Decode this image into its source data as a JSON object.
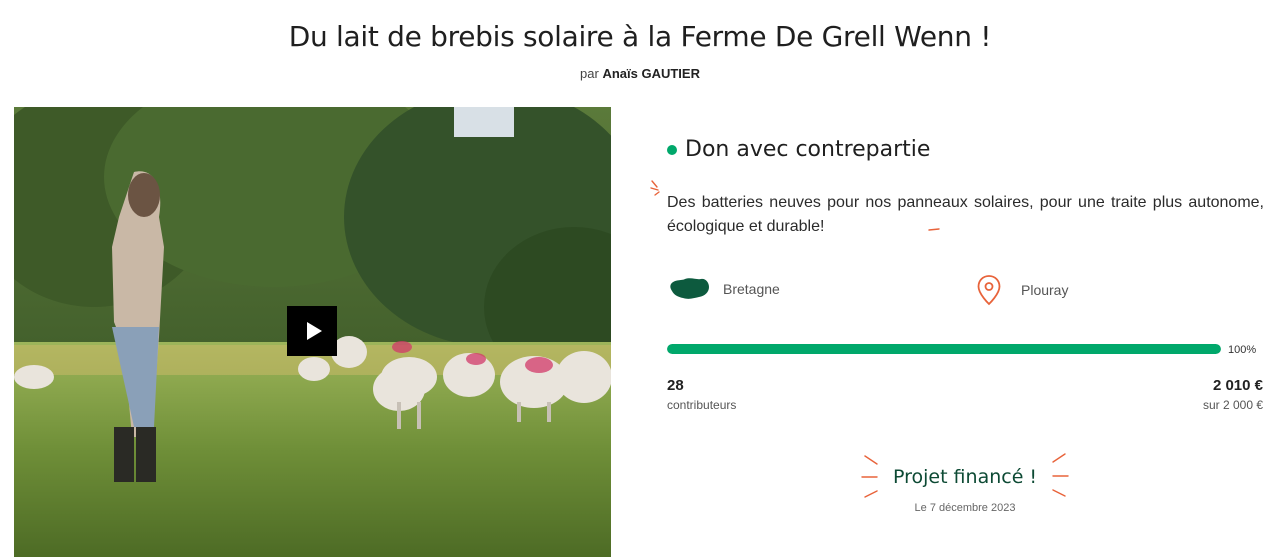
{
  "project": {
    "title": "Du lait de brebis solaire à la Ferme De Grell Wenn !",
    "by_prefix": "par",
    "author": "Anaïs GAUTIER"
  },
  "campaign": {
    "type_label": "Don avec contrepartie",
    "description": "Des batteries neuves pour nos panneaux solaires, pour une traite plus autonome, écologique et durable!",
    "region": "Bretagne",
    "city": "Plouray",
    "progress_percent": 100,
    "progress_label": "100%",
    "contributors_count": "28",
    "contributors_label": "contributeurs",
    "amount_raised": "2 010 €",
    "goal_label": "sur 2 000 €",
    "status_label": "Projet financé !",
    "status_date": "Le 7 décembre 2023"
  },
  "icons": {
    "play": "play-icon",
    "region": "bretagne-map-icon",
    "city": "location-pin-icon"
  },
  "colors": {
    "accent_green": "#00a86b",
    "dark_green": "#0d4a34",
    "accent_orange": "#e8633a"
  }
}
